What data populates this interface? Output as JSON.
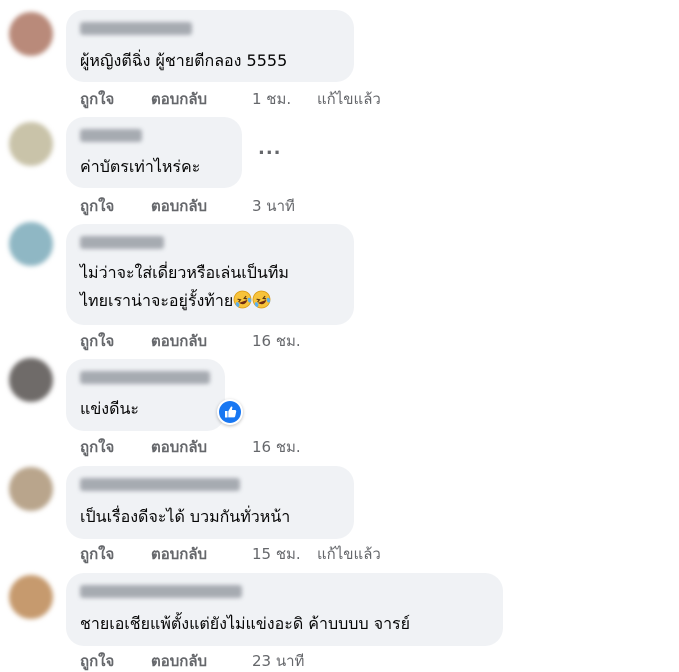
{
  "actions": {
    "like": "ถูกใจ",
    "reply": "ตอบกลับ",
    "edited": "แก้ไขแล้ว"
  },
  "comments": [
    {
      "lines": [
        "ผู้หญิงตีฉิ่ง ผู้ชายตีกลอง 5555"
      ],
      "time": "1 ชม.",
      "edited": true,
      "avatar_color": "#b98a7a"
    },
    {
      "lines": [
        "ค่าบัตรเท่าไหร่คะ"
      ],
      "time": "3 นาที",
      "edited": false,
      "avatar_color": "#c9c3a9",
      "more_menu": "..."
    },
    {
      "lines": [
        "ไม่ว่าจะใส่เดี่ยวหรือเล่นเป็นทีม",
        "ไทยเราน่าจะอยู่รั้งท้าย"
      ],
      "emoji": "rolling-on-floor-laughing-icon",
      "time": "16 ชม.",
      "edited": false,
      "avatar_color": "#8fb7c4"
    },
    {
      "lines": [
        "แข่งดีนะ"
      ],
      "time": "16 ชม.",
      "edited": false,
      "avatar_color": "#6f6b69",
      "reaction": "like-icon",
      "reaction_color": "#1877f2"
    },
    {
      "lines": [
        "เป็นเรื่องดีจะได้ บวมกันทั่วหน้า"
      ],
      "time": "15 ชม.",
      "edited": true,
      "avatar_color": "#b9a58c"
    },
    {
      "lines": [
        "ชายเอเชียแพ้ตั้งแต่ยังไม่แข่งอะดิ ค้าบบบบ จารย์"
      ],
      "time": "23 นาที",
      "edited": false,
      "avatar_color": "#c69a6e"
    }
  ]
}
